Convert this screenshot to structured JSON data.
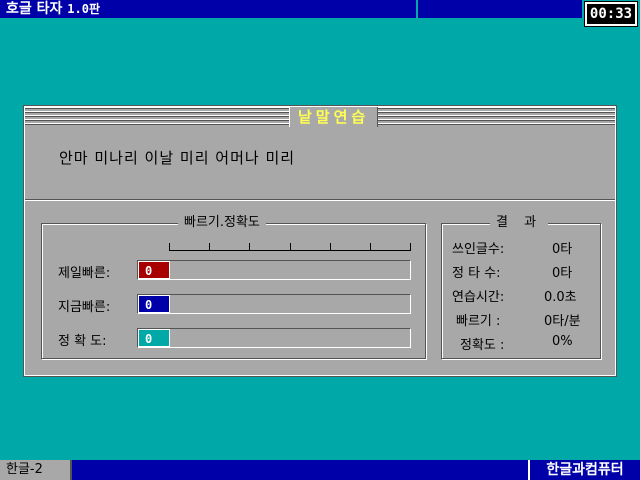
{
  "app": {
    "title": "호글 타자",
    "version": "1.0판"
  },
  "clock": "00:33",
  "panel": {
    "title": "낱말연습",
    "sentence": "안마 미나리 이날 미리 어머나 미리"
  },
  "speed_group": {
    "title": "빠르기.정확도",
    "tick_count": 7,
    "rows": [
      {
        "label": "제일빠른:",
        "value": "0",
        "color": "#a80000"
      },
      {
        "label": "지금빠른:",
        "value": "0",
        "color": "#0000a8"
      },
      {
        "label": "정 확 도:",
        "value": "0",
        "color": "#00a8a8"
      }
    ]
  },
  "result_group": {
    "title": "결 과",
    "rows": [
      {
        "label": "쓰인글수:",
        "value": "0타"
      },
      {
        "label": "정 타 수:",
        "value": "0타"
      },
      {
        "label": "연습시간:",
        "value": "0.0초"
      },
      {
        "label": "빠르기 :",
        "value": "0타/분"
      },
      {
        "label": "정확도 :",
        "value": "0%"
      }
    ]
  },
  "status": {
    "input_mode": "한글-2",
    "company": "한글과컴퓨터"
  }
}
